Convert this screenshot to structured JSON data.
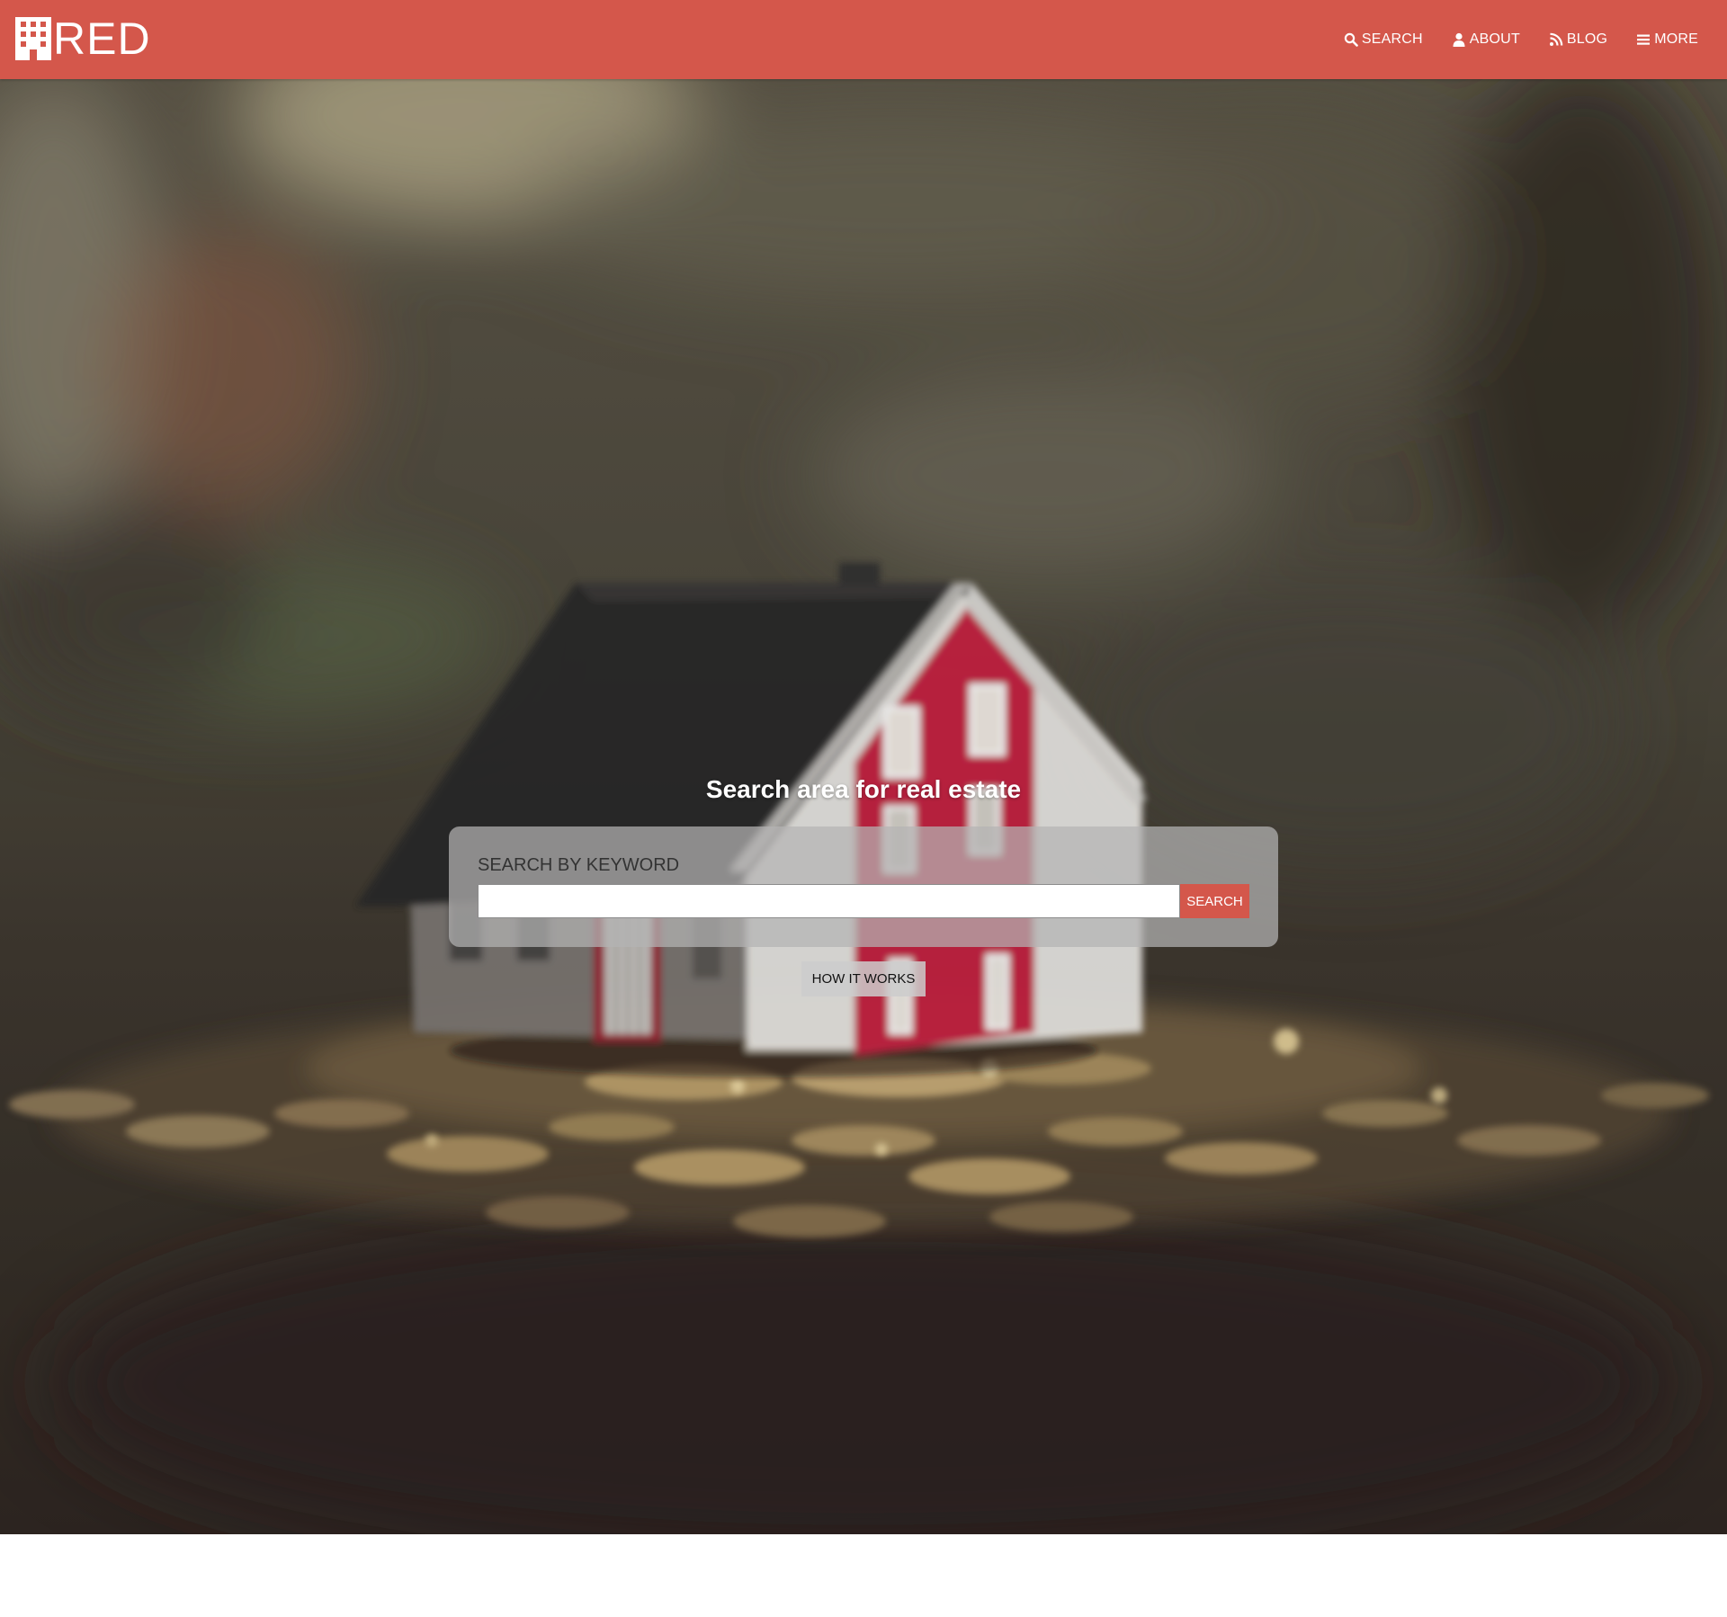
{
  "header": {
    "logo_text": "RED",
    "logo_icon": "building-icon",
    "brand_color": "#d4574b",
    "nav": [
      {
        "label": "SEARCH",
        "icon": "search-icon"
      },
      {
        "label": "ABOUT",
        "icon": "user-icon"
      },
      {
        "label": "BLOG",
        "icon": "rss-icon"
      },
      {
        "label": "MORE",
        "icon": "menu-icon"
      }
    ]
  },
  "hero": {
    "title": "Search area for real estate",
    "search_label": "SEARCH BY KEYWORD",
    "search_value": "",
    "search_placeholder": "",
    "search_button": "SEARCH",
    "how_button": "HOW IT WORKS"
  }
}
